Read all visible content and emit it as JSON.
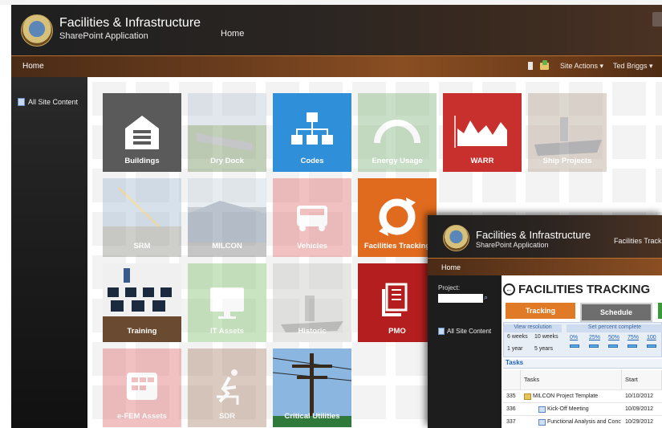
{
  "header": {
    "title": "Facilities & Infrastructure",
    "subtitle": "SharePoint Application",
    "home_link": "Home"
  },
  "navbar": {
    "home": "Home",
    "site_actions": "Site Actions ▾",
    "user": "Ted Briggs ▾"
  },
  "sidebar": {
    "all_site_content": "All Site Content"
  },
  "tiles": [
    {
      "label": "Buildings",
      "color": "#5a5a5a",
      "icon": "building-icon",
      "faded": false
    },
    {
      "label": "Dry Dock",
      "color": "#7aa26a",
      "icon": "dry-dock-photo",
      "faded": true
    },
    {
      "label": "Codes",
      "color": "#2f8fd8",
      "icon": "org-chart-icon",
      "faded": false
    },
    {
      "label": "Energy Usage",
      "color": "#7fb37a",
      "icon": "gauge-icon",
      "faded": true
    },
    {
      "label": "WARR",
      "color": "#c7302c",
      "icon": "area-chart-icon",
      "faded": false
    },
    {
      "label": "Ship Projects",
      "color": "#9b7a64",
      "icon": "ship-photo",
      "faded": true
    },
    {
      "label": "SRM",
      "color": "#6f8aa8",
      "icon": "crane-photo",
      "faded": true
    },
    {
      "label": "MILCON",
      "color": "#7a8896",
      "icon": "building-photo",
      "faded": true
    },
    {
      "label": "Vehicles",
      "color": "#e06a6a",
      "icon": "vehicle-icon",
      "faded": true
    },
    {
      "label": "Facilities Tracking",
      "color": "#e06a1d",
      "icon": "recycle-icon",
      "faded": false
    },
    {
      "label": "Training",
      "color": "#6a4a30",
      "icon": "classroom-photo",
      "faded": false
    },
    {
      "label": "IT Assets",
      "color": "#7fbf6a",
      "icon": "monitor-icon",
      "faded": true
    },
    {
      "label": "Historic",
      "color": "#8a8a8a",
      "icon": "historic-photo",
      "faded": true
    },
    {
      "label": "PMO",
      "color": "#b51e1e",
      "icon": "document-icon",
      "faded": false
    },
    {
      "label": "e-FEM Assets",
      "color": "#e06a6a",
      "icon": "database-icon",
      "faded": true
    },
    {
      "label": "SDR",
      "color": "#a8826a",
      "icon": "fall-hazard-icon",
      "faded": true
    },
    {
      "label": "Critical Utilities",
      "color": "#2f7a3a",
      "icon": "power-pole-photo",
      "faded": false
    }
  ],
  "overlay": {
    "title": "Facilities & Infrastructure",
    "subtitle": "SharePoint Application",
    "header_link": "Facilities Trackin",
    "nav_home": "Home",
    "project_label": "Project:",
    "all_site_content": "All Site Content",
    "page_title": "FACILITIES TRACKING",
    "buttons": {
      "tracking": "Tracking",
      "schedule": "Schedule"
    },
    "resolution_header": "View resolution",
    "percent_header": "Set percent complete",
    "resolutions": [
      "6 weeks",
      "10 weeks",
      "1 year",
      "5 years"
    ],
    "percents": [
      "0%",
      "25%",
      "50%",
      "75%",
      "100"
    ],
    "tasks_label": "Tasks",
    "columns": {
      "tasks": "Tasks",
      "start": "Start"
    },
    "rows": [
      {
        "id": "335",
        "task": "MILCON Project Template",
        "start": "10/10/2012"
      },
      {
        "id": "336",
        "task": "Kick-Off Meeting",
        "start": "10/09/2012"
      },
      {
        "id": "337",
        "task": "Functional Analysis and Conc",
        "start": "10/29/2012"
      }
    ]
  }
}
